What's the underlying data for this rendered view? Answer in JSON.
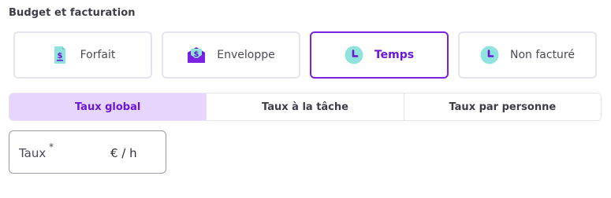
{
  "section": {
    "title": "Budget et facturation"
  },
  "billing_types": [
    {
      "label": "Forfait",
      "icon": "invoice-dollar-icon",
      "selected": false
    },
    {
      "label": "Enveloppe",
      "icon": "envelope-dollar-icon",
      "selected": false
    },
    {
      "label": "Temps",
      "icon": "clock-icon",
      "selected": true
    },
    {
      "label": "Non facturé",
      "icon": "clock-icon",
      "selected": false
    }
  ],
  "rate_tabs": [
    {
      "label": "Taux global",
      "active": true
    },
    {
      "label": "Taux à la tâche",
      "active": false
    },
    {
      "label": "Taux par personne",
      "active": false
    }
  ],
  "rate_field": {
    "label": "Taux",
    "required_mark": "*",
    "value": "",
    "unit": "€ / h"
  },
  "colors": {
    "accent": "#7c22e3",
    "accent_text": "#6a17d6",
    "active_tab_bg": "#e6d5fc",
    "icon_teal": "#8fe3dc",
    "icon_purple": "#6a17d6",
    "border": "#e3e4ee"
  }
}
